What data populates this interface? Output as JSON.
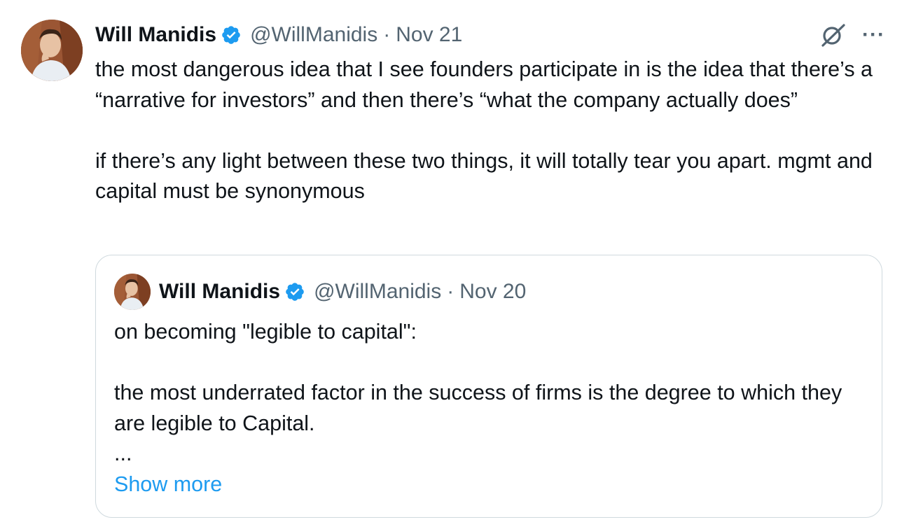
{
  "tweet": {
    "author": {
      "name": "Will Manidis",
      "handle": "@WillManidis",
      "verified": true
    },
    "separator": "·",
    "date": "Nov 21",
    "more_label": "···",
    "paragraphs": [
      "the most dangerous idea that I see founders participate in is the idea that there’s a “narrative for investors” and then there’s “what the company actually does”",
      "if there’s any light between these two things, it will totally tear you apart. mgmt and capital must be synonymous"
    ]
  },
  "quoted_tweet": {
    "author": {
      "name": "Will Manidis",
      "handle": "@WillManidis",
      "verified": true
    },
    "separator": "·",
    "date": "Nov 20",
    "lines": [
      "on becoming \"legible to capital\":",
      "the most underrated factor in the success of firms is the degree to which they are legible to Capital.",
      "..."
    ],
    "show_more_label": "Show more"
  },
  "icons": {
    "verified": "verified-badge-icon",
    "grok": "grok-icon",
    "more": "more-options-icon"
  },
  "colors": {
    "text": "#0f1419",
    "secondary": "#536471",
    "accent": "#1d9bf0",
    "border": "#cfd9de"
  }
}
